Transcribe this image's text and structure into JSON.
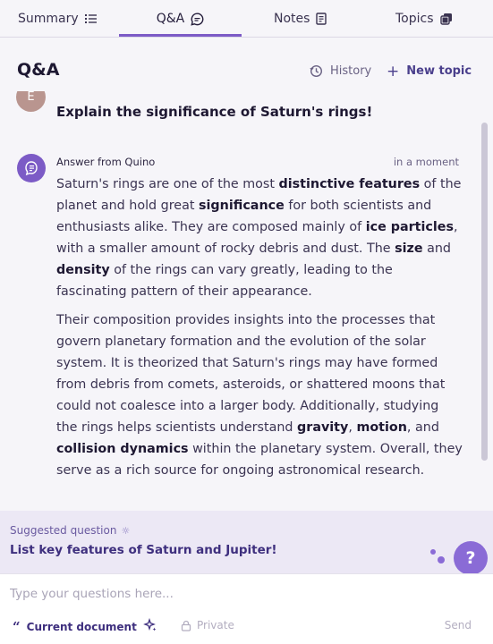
{
  "tabs": [
    {
      "label": "Summary",
      "icon": "list-icon"
    },
    {
      "label": "Q&A",
      "icon": "chat-icon",
      "active": true
    },
    {
      "label": "Notes",
      "icon": "note-icon"
    },
    {
      "label": "Topics",
      "icon": "cards-icon"
    }
  ],
  "header": {
    "title": "Q&A",
    "history_label": "History",
    "new_topic_label": "New topic"
  },
  "conversation": {
    "user_avatar_letter": "E",
    "question": "Explain the significance of Saturn's rings!",
    "answer_from": "Answer from Quino",
    "answer_time": "in a moment",
    "answer_paragraphs": [
      [
        {
          "t": "Saturn's rings are one of the most "
        },
        {
          "t": "distinctive features",
          "b": true
        },
        {
          "t": " of the planet and hold great "
        },
        {
          "t": "significance",
          "b": true
        },
        {
          "t": " for both scientists and enthusiasts alike. They are composed mainly of "
        },
        {
          "t": "ice particles",
          "b": true
        },
        {
          "t": ", with a smaller amount of rocky debris and dust. The "
        },
        {
          "t": "size",
          "b": true
        },
        {
          "t": " and "
        },
        {
          "t": "density",
          "b": true
        },
        {
          "t": " of the rings can vary greatly, leading to the fascinating pattern of their appearance."
        }
      ],
      [
        {
          "t": "Their composition provides insights into the processes that govern planetary formation and the evolution of the solar system. It is theorized that Saturn's rings may have formed from debris from comets, asteroids, or shattered moons that could not coalesce into a larger body. Additionally, studying the rings helps scientists understand "
        },
        {
          "t": "gravity",
          "b": true
        },
        {
          "t": ", "
        },
        {
          "t": "motion",
          "b": true
        },
        {
          "t": ", and "
        },
        {
          "t": "collision dynamics",
          "b": true
        },
        {
          "t": " within the planetary system. Overall, they serve as a rich source for ongoing astronomical research."
        }
      ]
    ]
  },
  "suggested": {
    "label": "Suggested question",
    "question": "List key features of Saturn and Jupiter!",
    "help_label": "?"
  },
  "input": {
    "placeholder": "Type your questions here...",
    "current_document_label": "Current document",
    "private_label": "Private",
    "send_label": "Send"
  },
  "colors": {
    "accent": "#7c5bc6",
    "suggested_bg": "#ece8f5",
    "background": "#f6f5f9"
  }
}
